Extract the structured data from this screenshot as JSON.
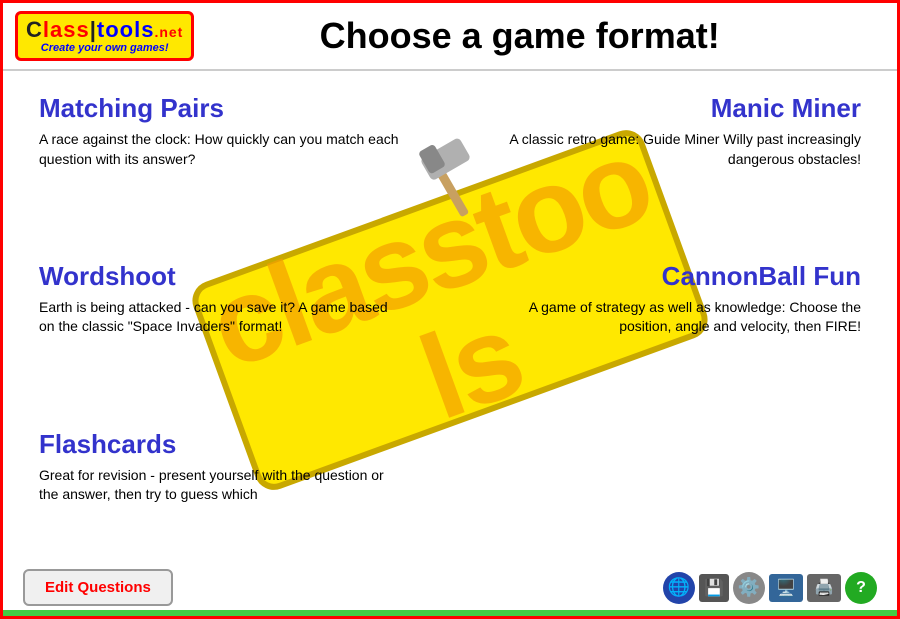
{
  "header": {
    "logo_text": "Classtools.net",
    "logo_subtitle": "Create your own games!",
    "page_title": "Choose a game format!"
  },
  "games": [
    {
      "id": "matching-pairs",
      "title": "Matching Pairs",
      "description": "A race against the clock: How quickly can you match each question with its answer?",
      "align": "left"
    },
    {
      "id": "manic-miner",
      "title": "Manic Miner",
      "description": "A classic retro game: Guide Miner Willy past increasingly dangerous obstacles!",
      "align": "right"
    },
    {
      "id": "wordshoot",
      "title": "Wordshoot",
      "description": "Earth is being attacked - can you save it? A game based on the classic \"Space Invaders\" format!",
      "align": "left"
    },
    {
      "id": "cannonball-fun",
      "title": "CannonBall Fun",
      "description": "A game of strategy as well as knowledge: Choose the position, angle and velocity, then FIRE!",
      "align": "right"
    },
    {
      "id": "flashcards",
      "title": "Flashcards",
      "description": "Great for revision - present yourself with the question or the answer, then try to guess which",
      "align": "left"
    }
  ],
  "footer": {
    "edit_button_label": "Edit Questions"
  },
  "toolbar": {
    "icons": [
      {
        "name": "globe-icon",
        "symbol": "🌐"
      },
      {
        "name": "save-icon",
        "symbol": "💾"
      },
      {
        "name": "gear-icon",
        "symbol": "⚙️"
      },
      {
        "name": "monitor-icon",
        "symbol": "🖥️"
      },
      {
        "name": "print-icon",
        "symbol": "🖨️"
      },
      {
        "name": "help-icon",
        "symbol": "?"
      }
    ]
  },
  "watermark": {
    "text": "classtoo"
  }
}
